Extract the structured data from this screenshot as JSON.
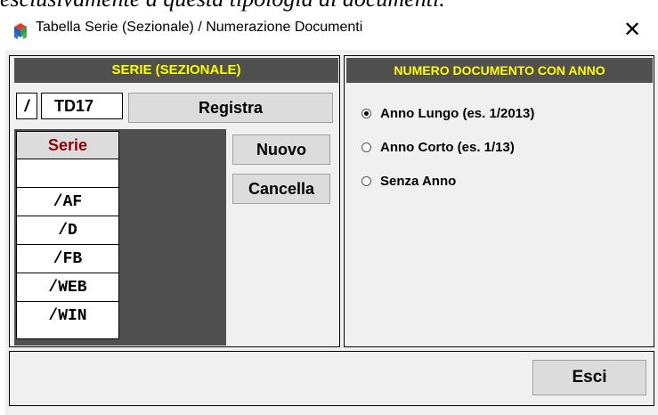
{
  "caption": "esclusivamente a questa tipologia di documenti.",
  "window": {
    "title": "Tabella Serie (Sezionale) / Numerazione Documenti",
    "close_glyph": "✕"
  },
  "left_panel": {
    "header": "SERIE (SEZIONALE)",
    "slash_label": "/",
    "code_value": "TD17",
    "register_button": "Registra",
    "new_button": "Nuovo",
    "delete_button": "Cancella",
    "list_header": "Serie",
    "list_items": [
      "",
      "/AF",
      "/D",
      "/FB",
      "/WEB",
      "/WIN"
    ]
  },
  "right_panel": {
    "header": "NUMERO DOCUMENTO CON ANNO",
    "options": [
      {
        "label": "Anno Lungo (es. 1/2013)",
        "selected": true
      },
      {
        "label": "Anno Corto (es. 1/13)",
        "selected": false
      },
      {
        "label": "Senza Anno",
        "selected": false
      }
    ]
  },
  "exit_button": "Esci",
  "colors": {
    "header_bg": "#505050",
    "header_text": "#ffff00",
    "list_header_text": "#8b0000"
  },
  "icons": {
    "app": "app-cubes-icon",
    "close": "close-icon"
  }
}
